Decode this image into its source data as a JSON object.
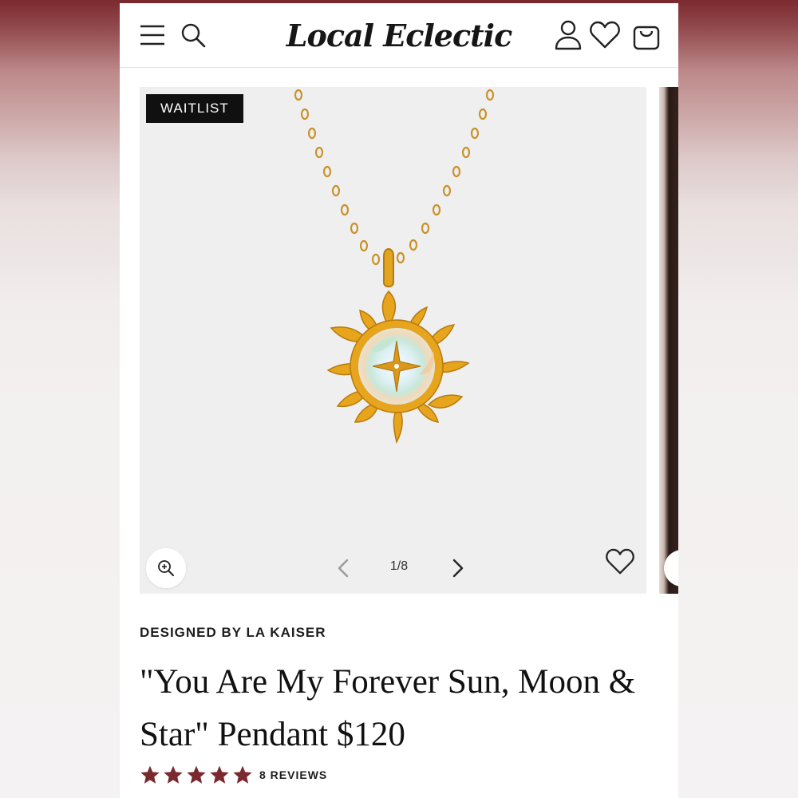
{
  "header": {
    "logo_text": "Local Eclectic",
    "icons": [
      "menu-icon",
      "search-icon",
      "account-icon",
      "heart-icon",
      "shopping-bag-icon"
    ]
  },
  "gallery": {
    "badge": "WAITLIST",
    "counter": "1/8",
    "current_index": 1,
    "total": 8,
    "icons": [
      "zoom-in-icon",
      "chevron-left-icon",
      "chevron-right-icon",
      "heart-icon"
    ]
  },
  "product": {
    "designer": "DESIGNED BY LA KAISER",
    "title": "\"You Are My Forever Sun, Moon & Star\" Pendant $120",
    "rating": 5,
    "rating_max": 5,
    "reviews": "8 REVIEWS"
  },
  "colors": {
    "accent_red": "#7a2a2f",
    "star": "#7a2a2f",
    "badge_bg": "#101010",
    "gold": "#e0a21c",
    "image_bg": "#efefef"
  }
}
